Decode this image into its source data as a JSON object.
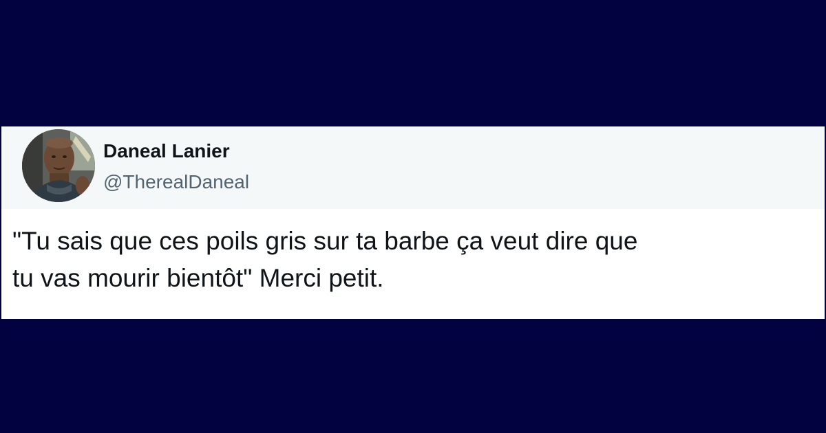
{
  "tweet": {
    "author": {
      "display_name": "Daneal Lanier",
      "handle": "@TherealDaneal",
      "avatar_icon": "profile-photo"
    },
    "text": "\"Tu sais que ces poils gris sur ta barbe ça veut dire que\ntu vas mourir bientôt\" Merci petit."
  },
  "colors": {
    "page_background": "#030240",
    "card_background": "#ffffff",
    "header_background": "#f5f8f9",
    "name_color": "#0f1419",
    "handle_color": "#536471"
  }
}
